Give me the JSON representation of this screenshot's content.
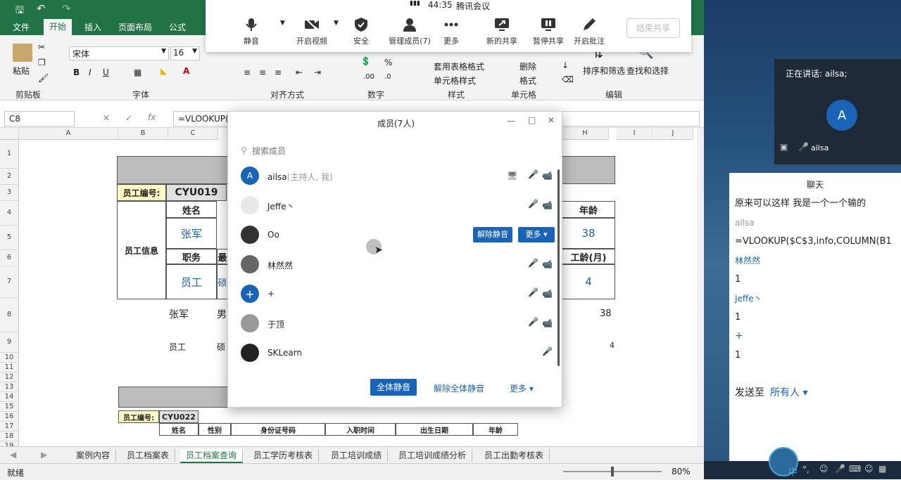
{
  "excel": {
    "ribbon_tabs": [
      "文件",
      "开始",
      "插入",
      "页面布局",
      "公式"
    ],
    "active_tab": "开始",
    "font_name": "宋体",
    "font_size": "16",
    "paste_label": "粘贴",
    "groups": [
      "剪贴板",
      "字体",
      "对齐方式",
      "数字",
      "样式",
      "单元格",
      "编辑"
    ],
    "style_buttons": [
      "套用表格格式",
      "单元格样式"
    ],
    "cell_buttons": [
      "删除",
      "格式"
    ],
    "edit_buttons": [
      "排序和筛选",
      "查找和选择"
    ],
    "name_box": "C8",
    "formula": "=VLOOKUP($",
    "columns": [
      "A",
      "B",
      "C",
      "H",
      "I",
      "J"
    ],
    "rows": [
      "1",
      "2",
      "3",
      "4",
      "5",
      "6",
      "7",
      "8",
      "9",
      "10",
      "11",
      "12",
      "13",
      "14",
      "15",
      "16",
      "17",
      "18",
      "19"
    ],
    "sheet": {
      "emp_no_label": "员工编号:",
      "emp_no": "CYU019",
      "name_label": "姓名",
      "name_value": "张军",
      "info_label": "员工信息",
      "position_label": "职务",
      "position_value": "员工",
      "col_partial_1": "最",
      "col_partial_2": "硕",
      "age_label": "年龄",
      "age_value": "38",
      "seniority_label": "工龄(月)",
      "seniority_value": "4",
      "row8_name": "张军",
      "row8_gender": "男",
      "row8_age": "38",
      "row9_pos": "员工",
      "row9_edu": "硕",
      "row9_val": "4",
      "emp_no_label_2": "员工编号:",
      "emp_no_2": "CYU022",
      "table2_headers": [
        "姓名",
        "性别",
        "身份证号码",
        "入职时间",
        "出生日期",
        "年龄"
      ]
    },
    "sheet_tabs": [
      "案例内容",
      "员工档案表",
      "员工档案查询",
      "员工学历考核表",
      "员工培训成绩",
      "员工培训成绩分析",
      "员工出勤考核表"
    ],
    "active_sheet": "员工档案查询",
    "status_ready": "就绪",
    "zoom": "80%"
  },
  "meeting_bar": {
    "timer": "44:35",
    "app_name": "腾讯会议",
    "buttons": [
      "静音",
      "开启视频",
      "安全",
      "管理成员(7)",
      "更多",
      "新的共享",
      "暂停共享",
      "开启批注"
    ],
    "end_share": "结束共享"
  },
  "members_dialog": {
    "title": "成员(7人)",
    "search_placeholder": "搜索成员",
    "members": [
      {
        "name": "ailsa",
        "tag": "(主持人, 我)",
        "avatar_letter": "A",
        "avatar_color": "#1a64b8"
      },
      {
        "name": "Jeffe丶",
        "tag": "",
        "avatar_letter": "",
        "avatar_color": "#dddddd"
      },
      {
        "name": "Oo",
        "tag": "",
        "avatar_letter": "",
        "avatar_color": "#333333"
      },
      {
        "name": "林然然",
        "tag": "",
        "avatar_letter": "",
        "avatar_color": "#666666"
      },
      {
        "name": "+",
        "tag": "",
        "avatar_letter": "+",
        "avatar_color": "#1a64b8"
      },
      {
        "name": "于顶",
        "tag": "",
        "avatar_letter": "",
        "avatar_color": "#999999"
      },
      {
        "name": "SKLearn",
        "tag": "",
        "avatar_letter": "",
        "avatar_color": "#222222"
      }
    ],
    "unmute_label": "解除静音",
    "more_label": "更多 ▾",
    "mute_all": "全体静音",
    "unmute_all": "解除全体静音",
    "footer_more": "更多 ▾"
  },
  "speaker_panel": {
    "speaking": "正在讲话: ailsa;",
    "avatar_letter": "A",
    "name": "ailsa"
  },
  "chat": {
    "title": "聊天",
    "messages": [
      {
        "sender": "",
        "text": "原来可以这样  我是一个一个输的"
      },
      {
        "sender": "ailsa",
        "text": "=VLOOKUP($C$3,info,COLUMN(B1"
      },
      {
        "sender": "林然然",
        "text": "1"
      },
      {
        "sender": "Jeffe丶",
        "text": "1"
      },
      {
        "sender": "+",
        "text": "1"
      }
    ],
    "send_to_label": "发送至",
    "send_to_target": "所有人 ▾"
  },
  "taskbar": {
    "ime": "中"
  }
}
